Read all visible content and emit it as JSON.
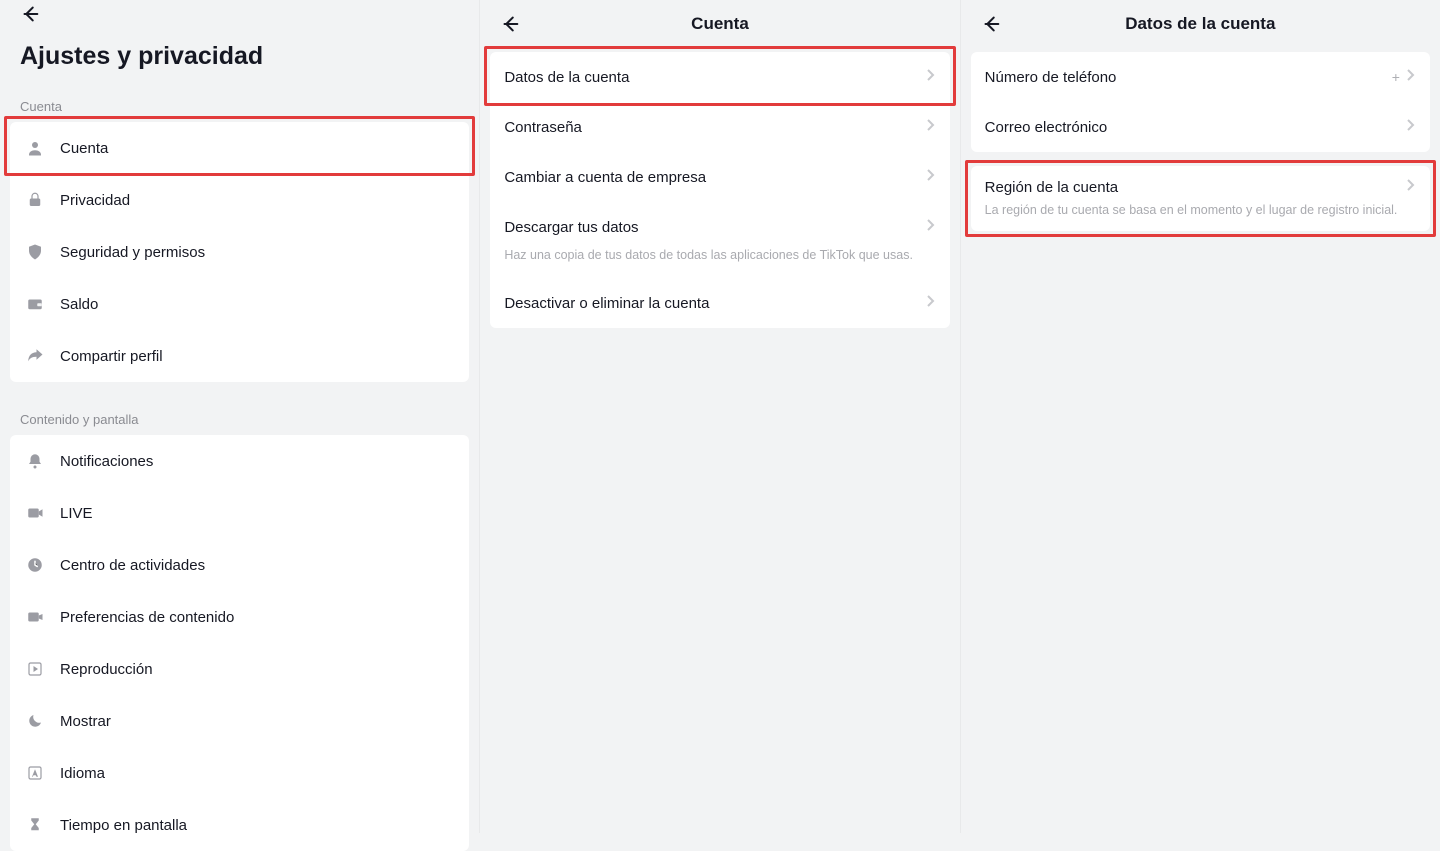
{
  "panel1": {
    "title": "Ajustes y privacidad",
    "section_account": "Cuenta",
    "items_account": [
      {
        "label": "Cuenta",
        "icon": "user"
      },
      {
        "label": "Privacidad",
        "icon": "lock"
      },
      {
        "label": "Seguridad y permisos",
        "icon": "shield"
      },
      {
        "label": "Saldo",
        "icon": "wallet"
      },
      {
        "label": "Compartir perfil",
        "icon": "share"
      }
    ],
    "section_content": "Contenido y pantalla",
    "items_content": [
      {
        "label": "Notificaciones",
        "icon": "bell"
      },
      {
        "label": "LIVE",
        "icon": "live"
      },
      {
        "label": "Centro de actividades",
        "icon": "clock"
      },
      {
        "label": "Preferencias de contenido",
        "icon": "video"
      },
      {
        "label": "Reproducción",
        "icon": "playback"
      },
      {
        "label": "Mostrar",
        "icon": "moon"
      },
      {
        "label": "Idioma",
        "icon": "language"
      },
      {
        "label": "Tiempo en pantalla",
        "icon": "hourglass"
      }
    ]
  },
  "panel2": {
    "title": "Cuenta",
    "items": [
      {
        "label": "Datos de la cuenta"
      },
      {
        "label": "Contraseña"
      },
      {
        "label": "Cambiar a cuenta de empresa"
      },
      {
        "label": "Descargar tus datos",
        "sub": "Haz una copia de tus datos de todas las aplicaciones de TikTok que usas."
      },
      {
        "label": "Desactivar o eliminar la cuenta"
      }
    ]
  },
  "panel3": {
    "title": "Datos de la cuenta",
    "items_top": [
      {
        "label": "Número de teléfono",
        "value": "+"
      },
      {
        "label": "Correo electrónico"
      }
    ],
    "region": {
      "label": "Región de la cuenta",
      "sub": "La región de tu cuenta se basa en el momento y el lugar de registro inicial."
    }
  }
}
